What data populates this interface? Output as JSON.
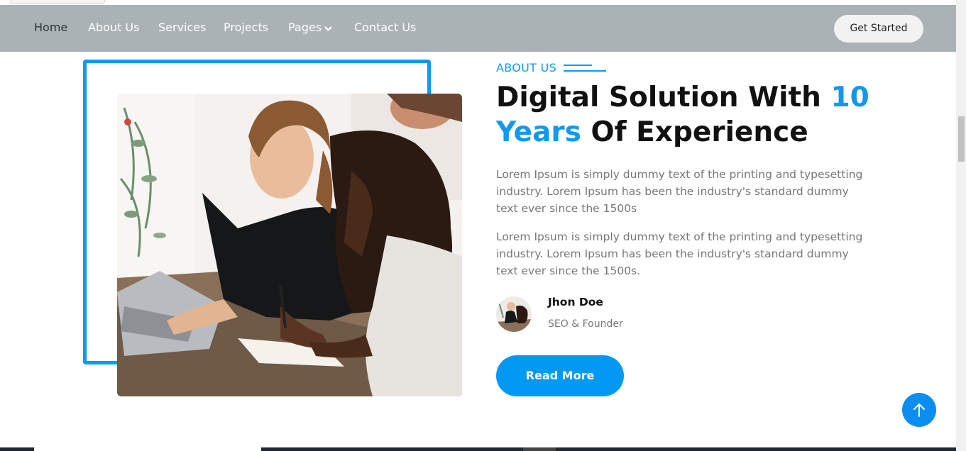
{
  "nav": {
    "items": [
      {
        "label": "Home",
        "active": true
      },
      {
        "label": "About Us"
      },
      {
        "label": "Services"
      },
      {
        "label": "Projects"
      },
      {
        "label": "Pages",
        "dropdown": true
      },
      {
        "label": "Contact Us"
      }
    ],
    "cta_label": "Get Started",
    "background": "#abb2b6"
  },
  "about": {
    "section_label": "ABOUT US",
    "heading_part1": "Digital Solution With ",
    "heading_highlight1": "10",
    "heading_highlight2": "Years",
    "heading_part2": " Of Experience",
    "paragraph1": "Lorem Ipsum is simply dummy text of the printing and typesetting industry. Lorem Ipsum has been the industry's standard dummy text ever since the 1500s",
    "paragraph2": "Lorem Ipsum is simply dummy text of the printing and typesetting industry. Lorem Ipsum has been the industry's standard dummy text ever since the 1500s.",
    "author_name": "Jhon Doe",
    "author_role": "SEO & Founder",
    "read_more_label": "Read More"
  },
  "icons": {
    "dropdown": "chevron-down-icon",
    "back_to_top": "arrow-up-icon"
  },
  "colors": {
    "accent": "#1398ee",
    "heading": "#111111",
    "body_text": "#777777"
  }
}
